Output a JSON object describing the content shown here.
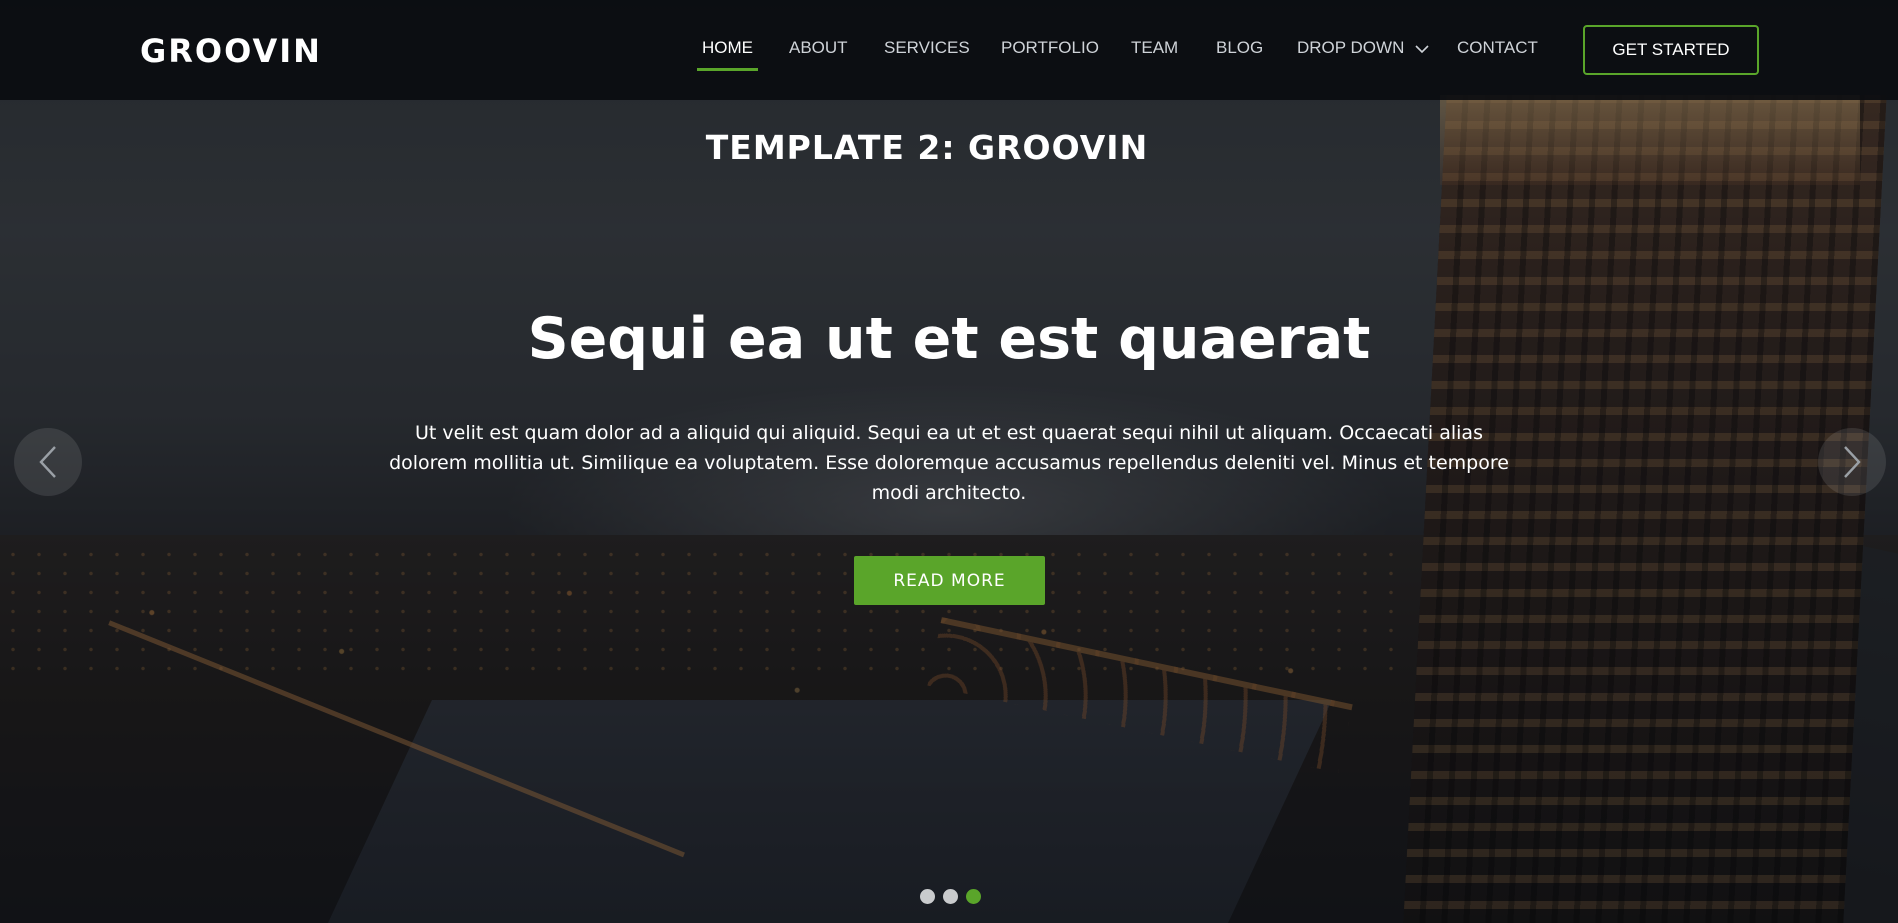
{
  "brand": {
    "name": "GROOVIN"
  },
  "nav": {
    "items": [
      {
        "label": "HOME",
        "active": true
      },
      {
        "label": "ABOUT",
        "active": false
      },
      {
        "label": "SERVICES",
        "active": false
      },
      {
        "label": "PORTFOLIO",
        "active": false
      },
      {
        "label": "TEAM",
        "active": false
      },
      {
        "label": "BLOG",
        "active": false
      },
      {
        "label": "DROP DOWN",
        "active": false,
        "icon": "chevron-down-icon"
      },
      {
        "label": "CONTACT",
        "active": false
      }
    ],
    "cta_label": "GET STARTED"
  },
  "hero": {
    "template_title": "TEMPLATE 2: GROOVIN",
    "headline": "Sequi ea ut et est quaerat",
    "lead": "Ut velit est quam dolor ad a aliquid qui aliquid. Sequi ea ut et est quaerat sequi nihil ut aliquam. Occaecati alias dolorem mollitia ut. Similique ea voluptatem. Esse doloremque accusamus repellendus deleniti vel. Minus et tempore modi architecto.",
    "button_label": "READ MORE",
    "prev_icon": "chevron-left-icon",
    "next_icon": "chevron-right-icon",
    "slides_count": 3,
    "active_slide": 3
  },
  "colors": {
    "accent": "#5aa52a",
    "header_bg": "#0a0c10",
    "text": "#ffffff"
  }
}
